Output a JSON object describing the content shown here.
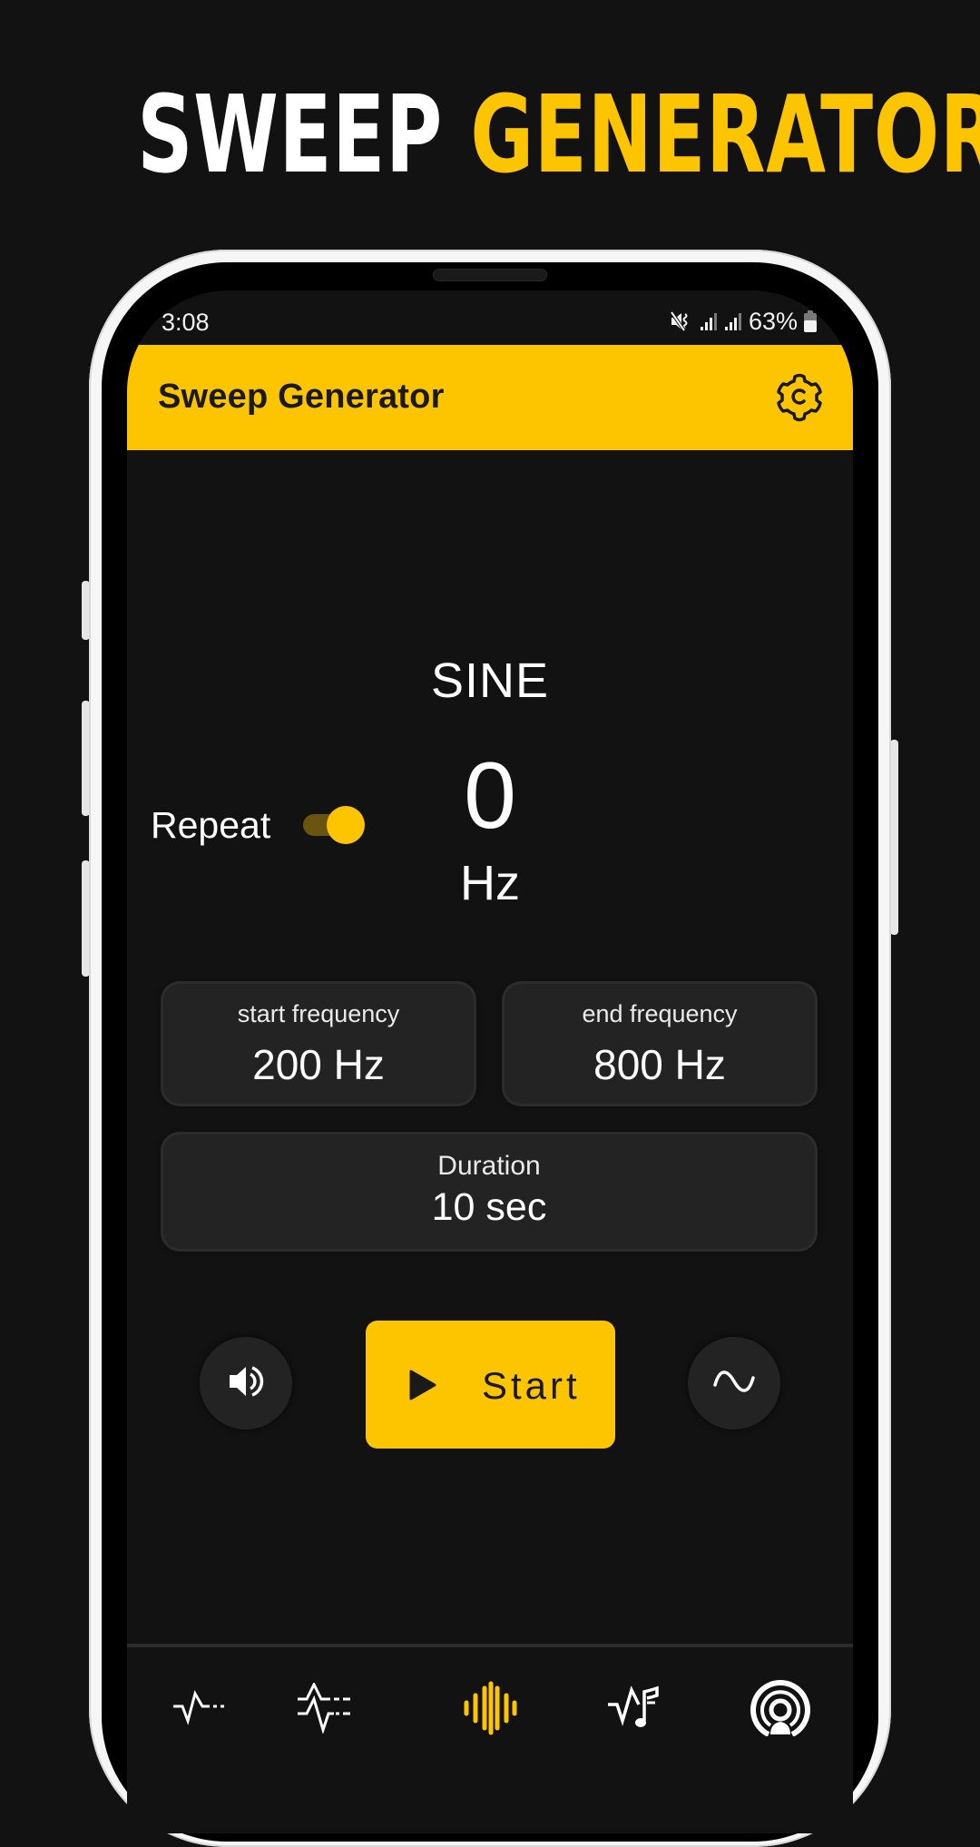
{
  "headline": {
    "word1": "SWEEP",
    "word2": "GENERATOR"
  },
  "status_bar": {
    "time": "3:08",
    "battery_percent": "63%",
    "icons": [
      "vibrate-mute-icon",
      "signal-icon",
      "signal-icon",
      "battery-icon"
    ]
  },
  "app_bar": {
    "title": "Sweep Generator",
    "settings_icon": "gear-icon"
  },
  "display": {
    "wave_type": "SINE",
    "frequency_value": "0",
    "frequency_unit": "Hz"
  },
  "repeat": {
    "label": "Repeat",
    "enabled": true
  },
  "cards": {
    "start_frequency": {
      "label": "start frequency",
      "value": "200 Hz"
    },
    "end_frequency": {
      "label": "end frequency",
      "value": "800 Hz"
    },
    "duration": {
      "label": "Duration",
      "value": "10 sec"
    }
  },
  "controls": {
    "volume_icon": "speaker-icon",
    "start_label": "Start",
    "start_icon": "play-icon",
    "waveform_icon": "sine-wave-icon"
  },
  "bottom_nav": {
    "items": [
      {
        "name": "pulse-icon",
        "active": false
      },
      {
        "name": "dual-pulse-icon",
        "active": false
      },
      {
        "name": "sweep-waveform-icon",
        "active": true
      },
      {
        "name": "pulse-music-icon",
        "active": false
      },
      {
        "name": "broadcast-icon",
        "active": false
      }
    ]
  },
  "colors": {
    "accent": "#fdc500",
    "background": "#121212",
    "card": "#232323",
    "text": "#ffffff",
    "toggle_track": "#6b5410"
  }
}
